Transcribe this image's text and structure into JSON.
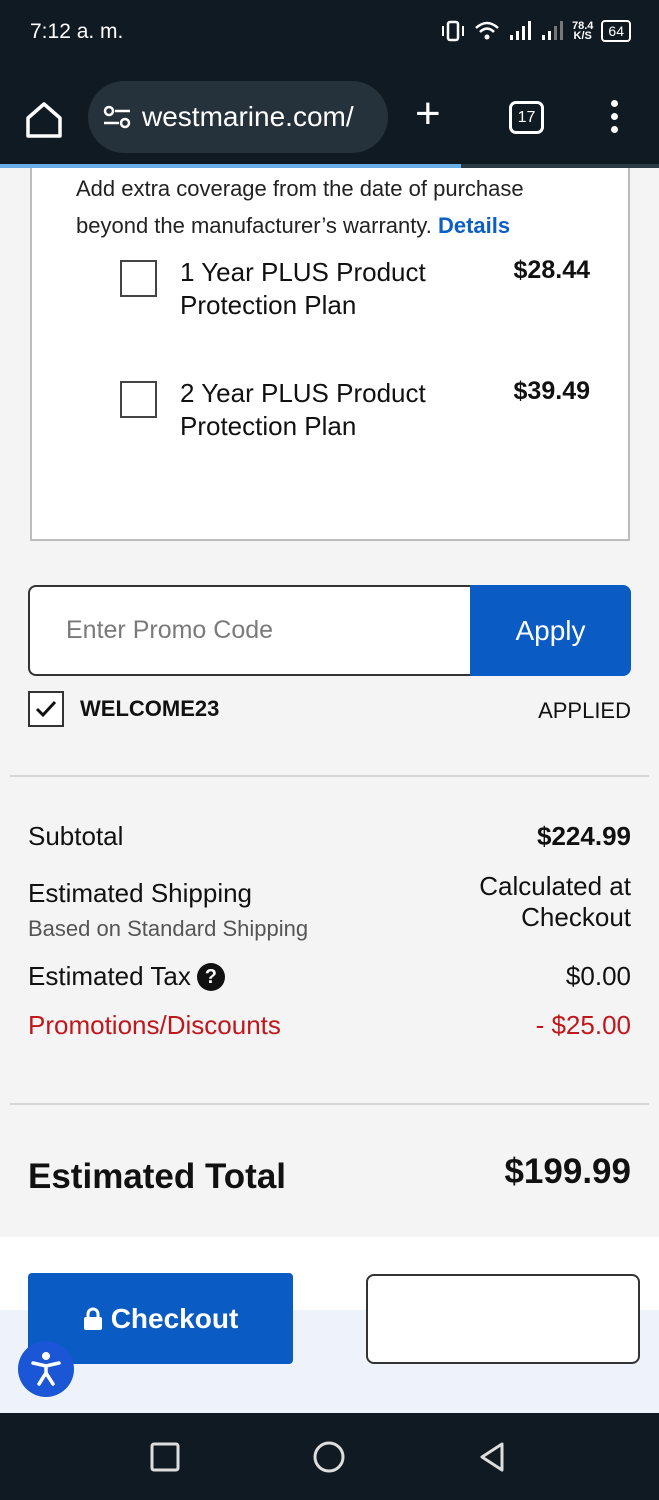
{
  "status": {
    "time": "7:12 a. m.",
    "net_speed_value": "78.4",
    "net_speed_unit": "K/S",
    "battery": "64"
  },
  "browser": {
    "url": "westmarine.com/",
    "tab_count": "17",
    "load_progress": 0.7
  },
  "protection": {
    "description": "Add extra coverage from the date of purchase beyond the manufacturer’s warranty.",
    "details_link": "Details",
    "plans": [
      {
        "name": "1 Year PLUS Product Protection Plan",
        "price": "$28.44",
        "checked": false
      },
      {
        "name": "2 Year PLUS Product Protection Plan",
        "price": "$39.49",
        "checked": false
      }
    ]
  },
  "promo": {
    "placeholder": "Enter Promo Code",
    "apply_label": "Apply",
    "applied_code": "WELCOME23",
    "applied_status": "APPLIED"
  },
  "summary": {
    "subtotal_label": "Subtotal",
    "subtotal_value": "$224.99",
    "shipping_label": "Estimated Shipping",
    "shipping_note": "Based on Standard Shipping",
    "shipping_value_line1": "Calculated at",
    "shipping_value_line2": "Checkout",
    "tax_label": "Estimated Tax",
    "tax_value": "$0.00",
    "promo_label": "Promotions/Discounts",
    "promo_value": "- $25.00",
    "total_label": "Estimated Total",
    "total_value": "$199.99"
  },
  "actions": {
    "checkout_label": "Checkout"
  },
  "colors": {
    "brand_blue": "#0b5bc4",
    "discount_red": "#c0171c",
    "link_blue": "#0b5fc6"
  }
}
